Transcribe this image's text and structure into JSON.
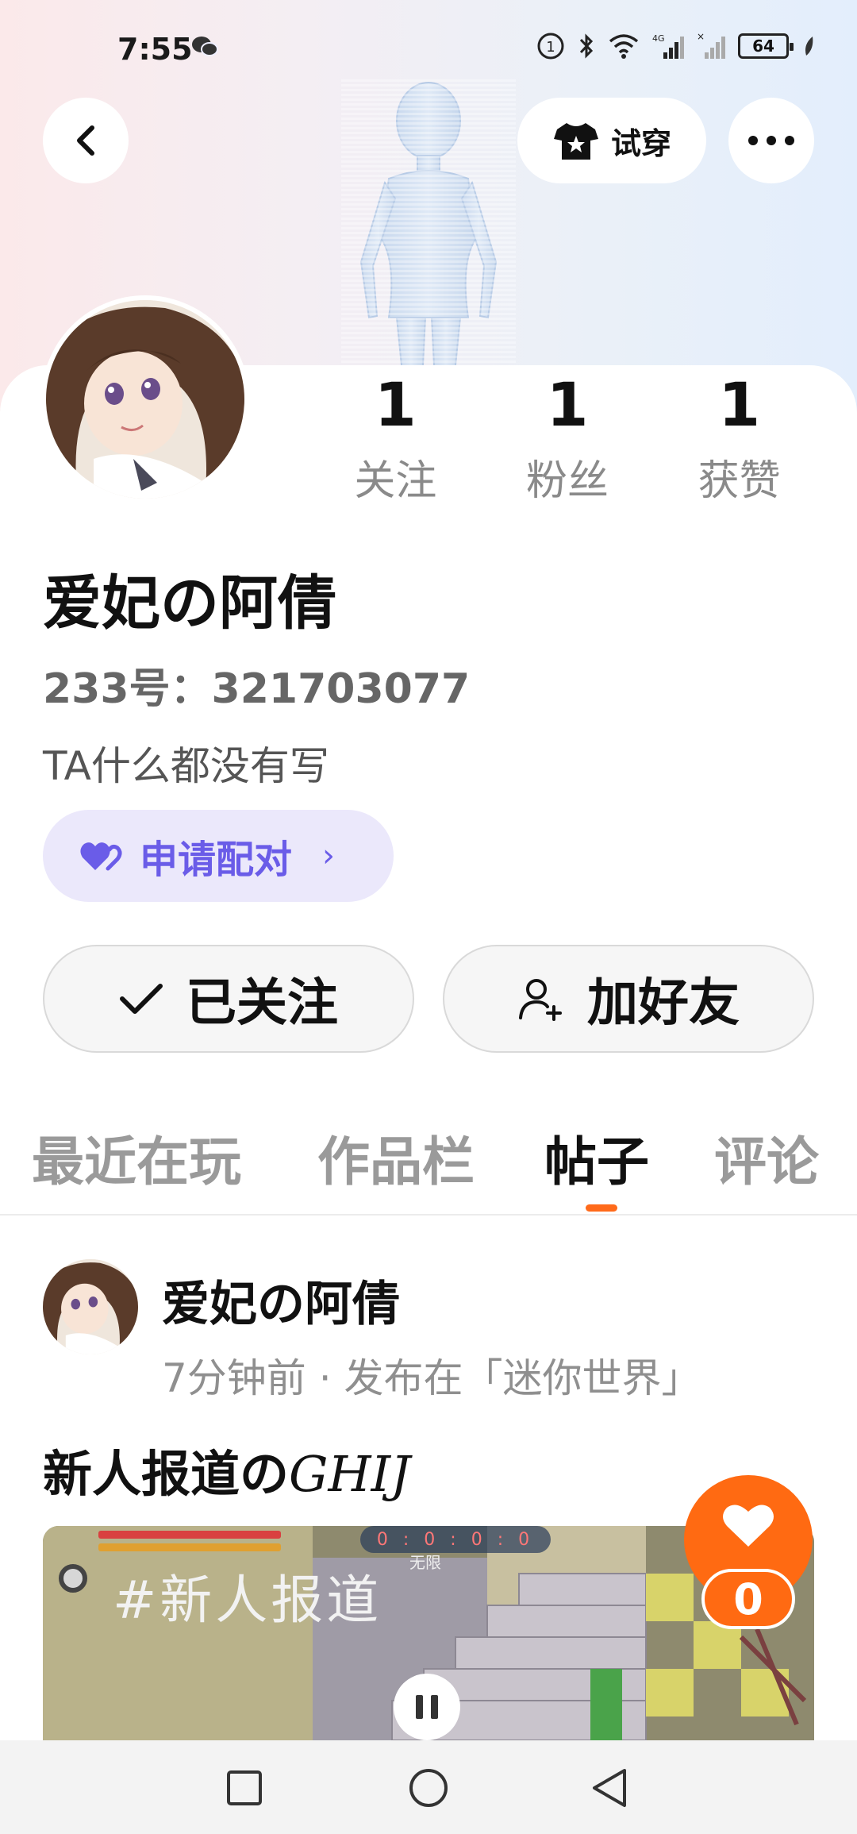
{
  "status_bar": {
    "time": "7:55",
    "battery": "64",
    "signal_label": "4G"
  },
  "header": {
    "try_on_label": "试穿"
  },
  "profile": {
    "stats": [
      {
        "value": "1",
        "label": "关注"
      },
      {
        "value": "1",
        "label": "粉丝"
      },
      {
        "value": "1",
        "label": "获赞"
      }
    ],
    "nickname": "爱妃の阿倩",
    "user_id": "233号：321703077",
    "bio": "TA什么都没有写",
    "pair_button_label": "申请配对",
    "pair_chevron": "›",
    "followed_label": "已关注",
    "add_friend_label": "加好友"
  },
  "tabs": [
    {
      "label": "最近在玩",
      "active": false
    },
    {
      "label": "作品栏",
      "active": false
    },
    {
      "label": "帖子",
      "active": true
    },
    {
      "label": "评论",
      "active": false
    }
  ],
  "post": {
    "author": "爱妃の阿倩",
    "meta": "7分钟前 · 发布在「迷你世界」",
    "title": "新人报道の",
    "title_fancy": "GHIJ",
    "media_tag": "#新人报道",
    "media_score": "0 : 0 : 0 : 0",
    "media_mode": "无限",
    "like_count": "0"
  },
  "colors": {
    "accent_orange": "#ff6a12",
    "pair_purple": "#6a5ce8",
    "pair_bg": "#ebe8fb"
  },
  "icons": {
    "back": "chevron-left-icon",
    "try_on": "tshirt-star-icon",
    "more": "more-dots-icon",
    "pair": "double-heart-icon",
    "followed": "check-icon",
    "add_friend": "add-user-icon",
    "like": "heart-icon",
    "pause": "pause-icon",
    "nav_recent": "square-icon",
    "nav_home": "circle-icon",
    "nav_back": "triangle-back-icon"
  }
}
